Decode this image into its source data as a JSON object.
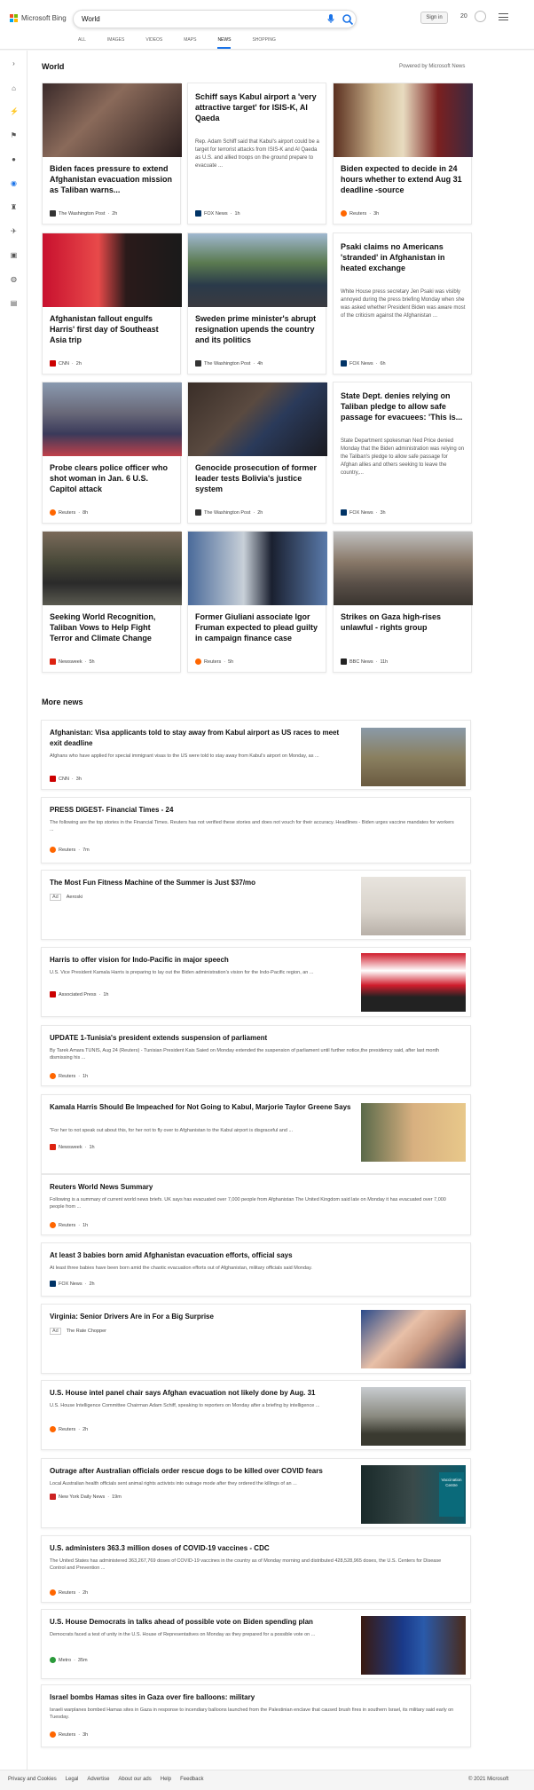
{
  "header": {
    "brand": "Microsoft Bing",
    "search_value": "World",
    "signin": "Sign in",
    "points": "20",
    "tabs": [
      "ALL",
      "IMAGES",
      "VIDEOS",
      "MAPS",
      "NEWS",
      "SHOPPING"
    ],
    "active_tab": "NEWS"
  },
  "section": {
    "title": "World",
    "powered": "Powered by Microsoft News"
  },
  "cards": [
    {
      "title": "Biden faces pressure to extend Afghanistan evacuation mission as Taliban warns...",
      "desc": "",
      "source": "The Washington Post",
      "time": "2h"
    },
    {
      "title": "Schiff says Kabul airport a 'very attractive target' for ISIS-K, Al Qaeda",
      "desc": "Rep. Adam Schiff said that Kabul's airport could be a target for terrorist attacks from ISIS-K and Al Qaeda as U.S. and allied troops on the ground prepare to evacuate ...",
      "source": "FOX News",
      "time": "1h"
    },
    {
      "title": "Biden expected to decide in 24 hours whether to extend Aug 31 deadline -source",
      "desc": "",
      "source": "Reuters",
      "time": "3h"
    },
    {
      "title": "Afghanistan fallout engulfs Harris' first day of Southeast Asia trip",
      "desc": "",
      "source": "CNN",
      "time": "2h"
    },
    {
      "title": "Sweden prime minister's abrupt resignation upends the country and its politics",
      "desc": "",
      "source": "The Washington Post",
      "time": "4h"
    },
    {
      "title": "Psaki claims no Americans 'stranded' in Afghanistan in heated exchange",
      "desc": "White House press secretary Jen Psaki was visibly annoyed during the press briefing Monday when she was asked whether President Biden was aware most of the criticism against the Afghanistan ...",
      "source": "FOX News",
      "time": "6h"
    },
    {
      "title": "Probe clears police officer who shot woman in Jan. 6 U.S. Capitol attack",
      "desc": "",
      "source": "Reuters",
      "time": "8h"
    },
    {
      "title": "Genocide prosecution of former leader tests Bolivia's justice system",
      "desc": "",
      "source": "The Washington Post",
      "time": "2h"
    },
    {
      "title": "State Dept. denies relying on Taliban pledge to allow safe passage for evacuees: 'This is...",
      "desc": "State Department spokesman Ned Price denied Monday that the Biden administration was relying on the Taliban's pledge to allow safe passage for Afghan allies and others seeking to leave the country,...",
      "source": "FOX News",
      "time": "3h"
    },
    {
      "title": "Seeking World Recognition, Taliban Vows to Help Fight Terror and Climate Change",
      "desc": "",
      "source": "Newsweek",
      "time": "5h"
    },
    {
      "title": "Former Giuliani associate Igor Fruman expected to plead guilty in campaign finance case",
      "desc": "",
      "source": "Reuters",
      "time": "5h"
    },
    {
      "title": "Strikes on Gaza high-rises unlawful - rights group",
      "desc": "",
      "source": "BBC News",
      "time": "11h"
    }
  ],
  "more": {
    "title": "More news",
    "items": [
      {
        "title": "Afghanistan: Visa applicants told to stay away from Kabul airport as US races to meet exit deadline",
        "desc": "Afghans who have applied for special immigrant visas to the US were told to stay away from Kabul's airport on Monday, as ...",
        "source": "CNN",
        "time": "3h"
      },
      {
        "title": "PRESS DIGEST- Financial Times - 24",
        "desc": "The following are the top stories in the Financial Times. Reuters has not verified these stories and does not vouch for their accuracy. Headlines - Biden urges vaccine mandates for workers ...",
        "source": "Reuters",
        "time": "7m"
      },
      {
        "title": "The Most Fun Fitness Machine of the Summer is Just $37/mo",
        "desc": "",
        "source": "Aeroski",
        "time": "",
        "ad": "Ad"
      },
      {
        "title": "Harris to offer vision for Indo-Pacific in major speech",
        "desc": "U.S. Vice President Kamala Harris is preparing to lay out the Biden administration's vision for the Indo-Pacific region, an ...",
        "source": "Associated Press",
        "time": "1h"
      },
      {
        "title": "UPDATE 1-Tunisia's president extends suspension of parliament",
        "desc": "By Tarek Amara TUNIS, Aug 24 (Reuters) - Tunisian President Kais Saied on Monday extended the suspension of parliament until further notice,the presidency said, after last month dismissing his ...",
        "source": "Reuters",
        "time": "1h"
      },
      {
        "title": "Kamala Harris Should Be Impeached for Not Going to Kabul, Marjorie Taylor Greene Says",
        "desc": "\"For her to not speak out about this, for her not to fly over to Afghanistan to the Kabul airport is disgraceful and ...",
        "source": "Newsweek",
        "time": "1h"
      },
      {
        "title": "Reuters World News Summary",
        "desc": "Following is a summary of current world news briefs. UK says has evacuated over 7,000 people from Afghanistan The United Kingdom said late on Monday it has evacuated over 7,000 people from ...",
        "source": "Reuters",
        "time": "1h"
      },
      {
        "title": "At least 3 babies born amid Afghanistan evacuation efforts, official says",
        "desc": "At least three babies have been born amid the chaotic evacuation efforts out of Afghanistan, military officials said Monday.",
        "source": "FOX News",
        "time": "2h"
      },
      {
        "title": "Virginia: Senior Drivers Are in For a Big Surprise",
        "desc": "",
        "source": "The Rate Chopper",
        "time": "",
        "ad": "Ad"
      },
      {
        "title": "U.S. House intel panel chair says Afghan evacuation not likely done by Aug. 31",
        "desc": "U.S. House Intelligence Committee Chairman Adam Schiff, speaking to reporters on Monday after a briefing by intelligence ...",
        "source": "Reuters",
        "time": "2h"
      },
      {
        "title": "Outrage after Australian officials order rescue dogs to be killed over COVID fears",
        "desc": "Local Australian health officials sent animal rights activists into outrage mode after they ordered the killings of an ...",
        "source": "New York Daily News",
        "time": "19m"
      },
      {
        "title": "U.S. administers 363.3 million doses of COVID-19 vaccines - CDC",
        "desc": "The United States has administered 363,267,769 doses of COVID-19 vaccines in the country as of Monday morning and distributed 428,528,965 doses, the U.S. Centers for Disease Control and Prevention ...",
        "source": "Reuters",
        "time": "2h"
      },
      {
        "title": "U.S. House Democrats in talks ahead of possible vote on Biden spending plan",
        "desc": "Democrats faced a test of unity in the U.S. House of Representatives on Monday as they prepared for a possible vote on ...",
        "source": "Metro",
        "time": "35m"
      },
      {
        "title": "Israel bombs Hamas sites in Gaza over fire balloons: military",
        "desc": "Israeli warplanes bombed Hamas sites in Gaza in response to incendiary balloons launched from the Palestinian enclave that caused brush fires in southern Israel, its military said early on Tuesday.",
        "source": "Reuters",
        "time": "3h"
      }
    ]
  },
  "image_caption": {
    "text": "Vaccination Centre"
  },
  "footer": {
    "links": [
      "Privacy and Cookies",
      "Legal",
      "Advertise",
      "About our ads",
      "Help",
      "Feedback"
    ],
    "copyright": "© 2021 Microsoft"
  }
}
